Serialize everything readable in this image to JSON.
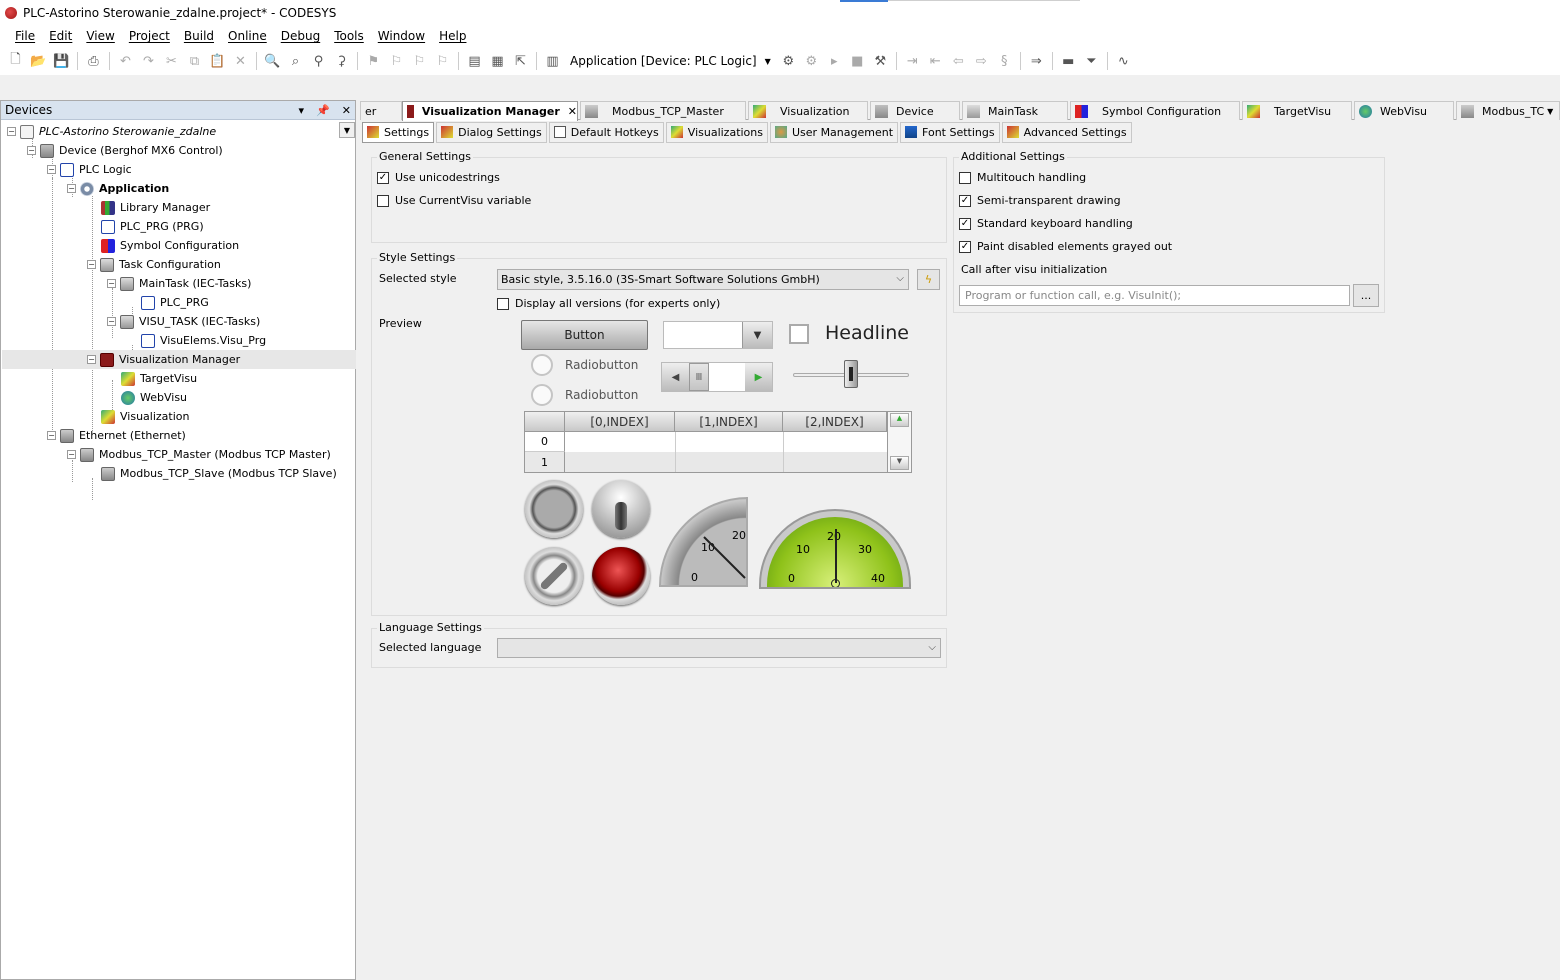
{
  "window": {
    "title": "PLC-Astorino Sterowanie_zdalne.project* - CODESYS"
  },
  "menu": [
    "File",
    "Edit",
    "View",
    "Project",
    "Build",
    "Online",
    "Debug",
    "Tools",
    "Window",
    "Help"
  ],
  "toolbar": {
    "application_selector": "Application [Device: PLC Logic]"
  },
  "devices_pane": {
    "title": "Devices",
    "tree": [
      {
        "label": "PLC-Astorino Sterowanie_zdalne",
        "icon": "project-icon",
        "italic": true
      },
      {
        "label": "Device (Berghof MX6 Control)",
        "icon": "device-icon"
      },
      {
        "label": "PLC Logic",
        "icon": "plc-logic-icon"
      },
      {
        "label": "Application",
        "icon": "application-icon",
        "bold": true
      },
      {
        "label": "Library Manager",
        "icon": "library-icon"
      },
      {
        "label": "PLC_PRG (PRG)",
        "icon": "program-icon"
      },
      {
        "label": "Symbol Configuration",
        "icon": "symbol-config-icon"
      },
      {
        "label": "Task Configuration",
        "icon": "task-config-icon"
      },
      {
        "label": "MainTask (IEC-Tasks)",
        "icon": "task-icon"
      },
      {
        "label": "PLC_PRG",
        "icon": "program-call-icon"
      },
      {
        "label": "VISU_TASK (IEC-Tasks)",
        "icon": "task-icon"
      },
      {
        "label": "VisuElems.Visu_Prg",
        "icon": "program-call-icon"
      },
      {
        "label": "Visualization Manager",
        "icon": "visu-manager-icon",
        "selected": true
      },
      {
        "label": "TargetVisu",
        "icon": "target-visu-icon"
      },
      {
        "label": "WebVisu",
        "icon": "web-visu-icon"
      },
      {
        "label": "Visualization",
        "icon": "visualization-icon"
      },
      {
        "label": "Ethernet (Ethernet)",
        "icon": "ethernet-icon"
      },
      {
        "label": "Modbus_TCP_Master (Modbus TCP Master)",
        "icon": "modbus-icon"
      },
      {
        "label": "Modbus_TCP_Slave (Modbus TCP Slave)",
        "icon": "modbus-icon"
      }
    ]
  },
  "editor_tabs": [
    {
      "label": "er"
    },
    {
      "label": "Visualization Manager",
      "active": true,
      "closable": true
    },
    {
      "label": "Modbus_TCP_Master"
    },
    {
      "label": "Visualization"
    },
    {
      "label": "Device"
    },
    {
      "label": "MainTask"
    },
    {
      "label": "Symbol Configuration"
    },
    {
      "label": "TargetVisu"
    },
    {
      "label": "WebVisu"
    },
    {
      "label": "Modbus_TC"
    }
  ],
  "sub_tabs": [
    {
      "label": "Settings",
      "active": true
    },
    {
      "label": "Dialog Settings"
    },
    {
      "label": "Default Hotkeys"
    },
    {
      "label": "Visualizations"
    },
    {
      "label": "User Management"
    },
    {
      "label": "Font Settings"
    },
    {
      "label": "Advanced Settings"
    }
  ],
  "general_settings": {
    "title": "General Settings",
    "use_unicode": {
      "label": "Use unicodestrings",
      "checked": true
    },
    "use_currentvisu": {
      "label": "Use CurrentVisu variable",
      "checked": false
    }
  },
  "style_settings": {
    "title": "Style Settings",
    "selected_style_label": "Selected style",
    "selected_style_value": "Basic style, 3.5.16.0 (3S-Smart Software Solutions GmbH)",
    "display_all_versions": {
      "label": "Display all versions (for experts only)",
      "checked": false
    },
    "preview_label": "Preview",
    "preview": {
      "button": "Button",
      "radio1": "Radiobutton",
      "radio2": "Radiobutton",
      "headline": "Headline",
      "table_headers": [
        "[0,INDEX]",
        "[1,INDEX]",
        "[2,INDEX]"
      ],
      "table_rows": [
        "0",
        "1"
      ],
      "meter1_labels": [
        "10",
        "20",
        "0"
      ],
      "meter2_labels": [
        "10",
        "20",
        "30",
        "0",
        "40"
      ]
    }
  },
  "language_settings": {
    "title": "Language Settings",
    "selected_language_label": "Selected language",
    "selected_language_value": ""
  },
  "additional_settings": {
    "title": "Additional Settings",
    "multitouch": {
      "label": "Multitouch handling",
      "checked": false
    },
    "semi_transparent": {
      "label": "Semi-transparent drawing",
      "checked": true
    },
    "standard_keyboard": {
      "label": "Standard keyboard handling",
      "checked": true
    },
    "paint_disabled": {
      "label": "Paint disabled elements grayed out",
      "checked": true
    },
    "call_after_init_label": "Call after visu initialization",
    "call_after_init_placeholder": "Program or function call, e.g. VisuInit();",
    "browse_button": "..."
  }
}
